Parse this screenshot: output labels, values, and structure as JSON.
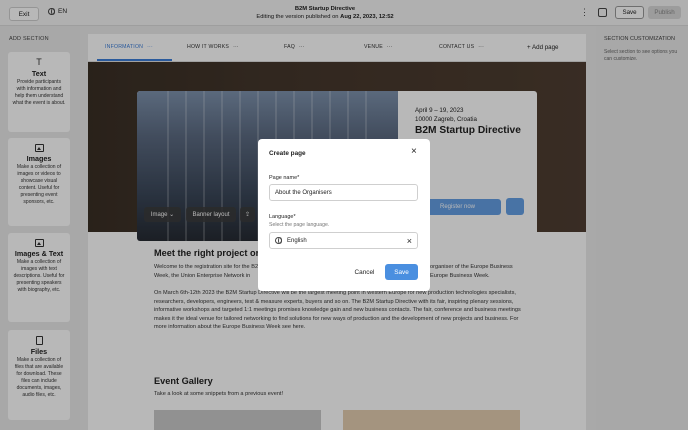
{
  "topbar": {
    "exit_label": "Exit",
    "language": "EN",
    "title": "B2M Startup Directive",
    "subtitle_prefix": "Editing the version published on",
    "subtitle_date": "Aug 22, 2023, 12:52",
    "save_label": "Save",
    "publish_label": "Publish"
  },
  "left_sidebar": {
    "title": "ADD SECTION",
    "sections": [
      {
        "name": "Text",
        "desc": "Provide participants with information and help them understand what the event is about.",
        "icon": "text-icon"
      },
      {
        "name": "Images",
        "desc": "Make a collection of images or videos to showcase visual content. Useful for presenting event sponsors, etc.",
        "icon": "image-icon"
      },
      {
        "name": "Images & Text",
        "desc": "Make a collection of images with text descriptions. Useful for presenting speakers with biography, etc.",
        "icon": "image-icon"
      },
      {
        "name": "Files",
        "desc": "Make a collection of files that are available for download. These files can include documents, images, audio files, etc.",
        "icon": "file-icon"
      }
    ]
  },
  "right_sidebar": {
    "title": "SECTION CUSTOMIZATION",
    "desc": "Select section to see options you can customize."
  },
  "nav": {
    "items": [
      "INFORMATION",
      "HOW IT WORKS",
      "FAQ",
      "VENUE",
      "CONTACT US"
    ],
    "add_page": "Add page",
    "dots": "···"
  },
  "hero": {
    "date": "April 9 – 19, 2023",
    "location": "10000 Zagreb, Croatia",
    "title": "B2M Startup Directive",
    "register_label": "Register now",
    "image_chip": "Image",
    "banner_chip": "Banner layout"
  },
  "content": {
    "heading": "Meet the right project or",
    "p1a": "Welcome to the registration site for the B2M",
    "p1b": "organiser of the Europe Business",
    "p1c": "Week, the Union Enterprise Network in",
    "p1d": "Europe Business Week.",
    "p2": "On March 6th-12th 2023 the B2M Startup Directive will be the largest meeting point in western Europe for new production technologies specialists, researchers, developers, engineers, test & measure experts, buyers and so on. The B2M Startup Directive with its fair, inspiring plenary sessions, informative workshops and targeted 1:1 meetings promises knowledge gain and new business contacts. The fair, conference and business meetings makes it the ideal venue for tailored networking to find solutions for new ways of production and the development of new projects and business. For more information about the Europe Business Week see here."
  },
  "gallery": {
    "heading": "Event Gallery",
    "subtitle": "Take a look at some snippets from a previous event!"
  },
  "modal": {
    "title": "Create page",
    "page_name_label": "Page name*",
    "page_name_value": "About the Organisers",
    "language_label": "Language*",
    "language_help": "Select the page language.",
    "language_value": "English",
    "cancel_label": "Cancel",
    "save_label": "Save"
  },
  "colors": {
    "accent": "#4a8fe0",
    "nav_active": "#3b7dd8"
  }
}
